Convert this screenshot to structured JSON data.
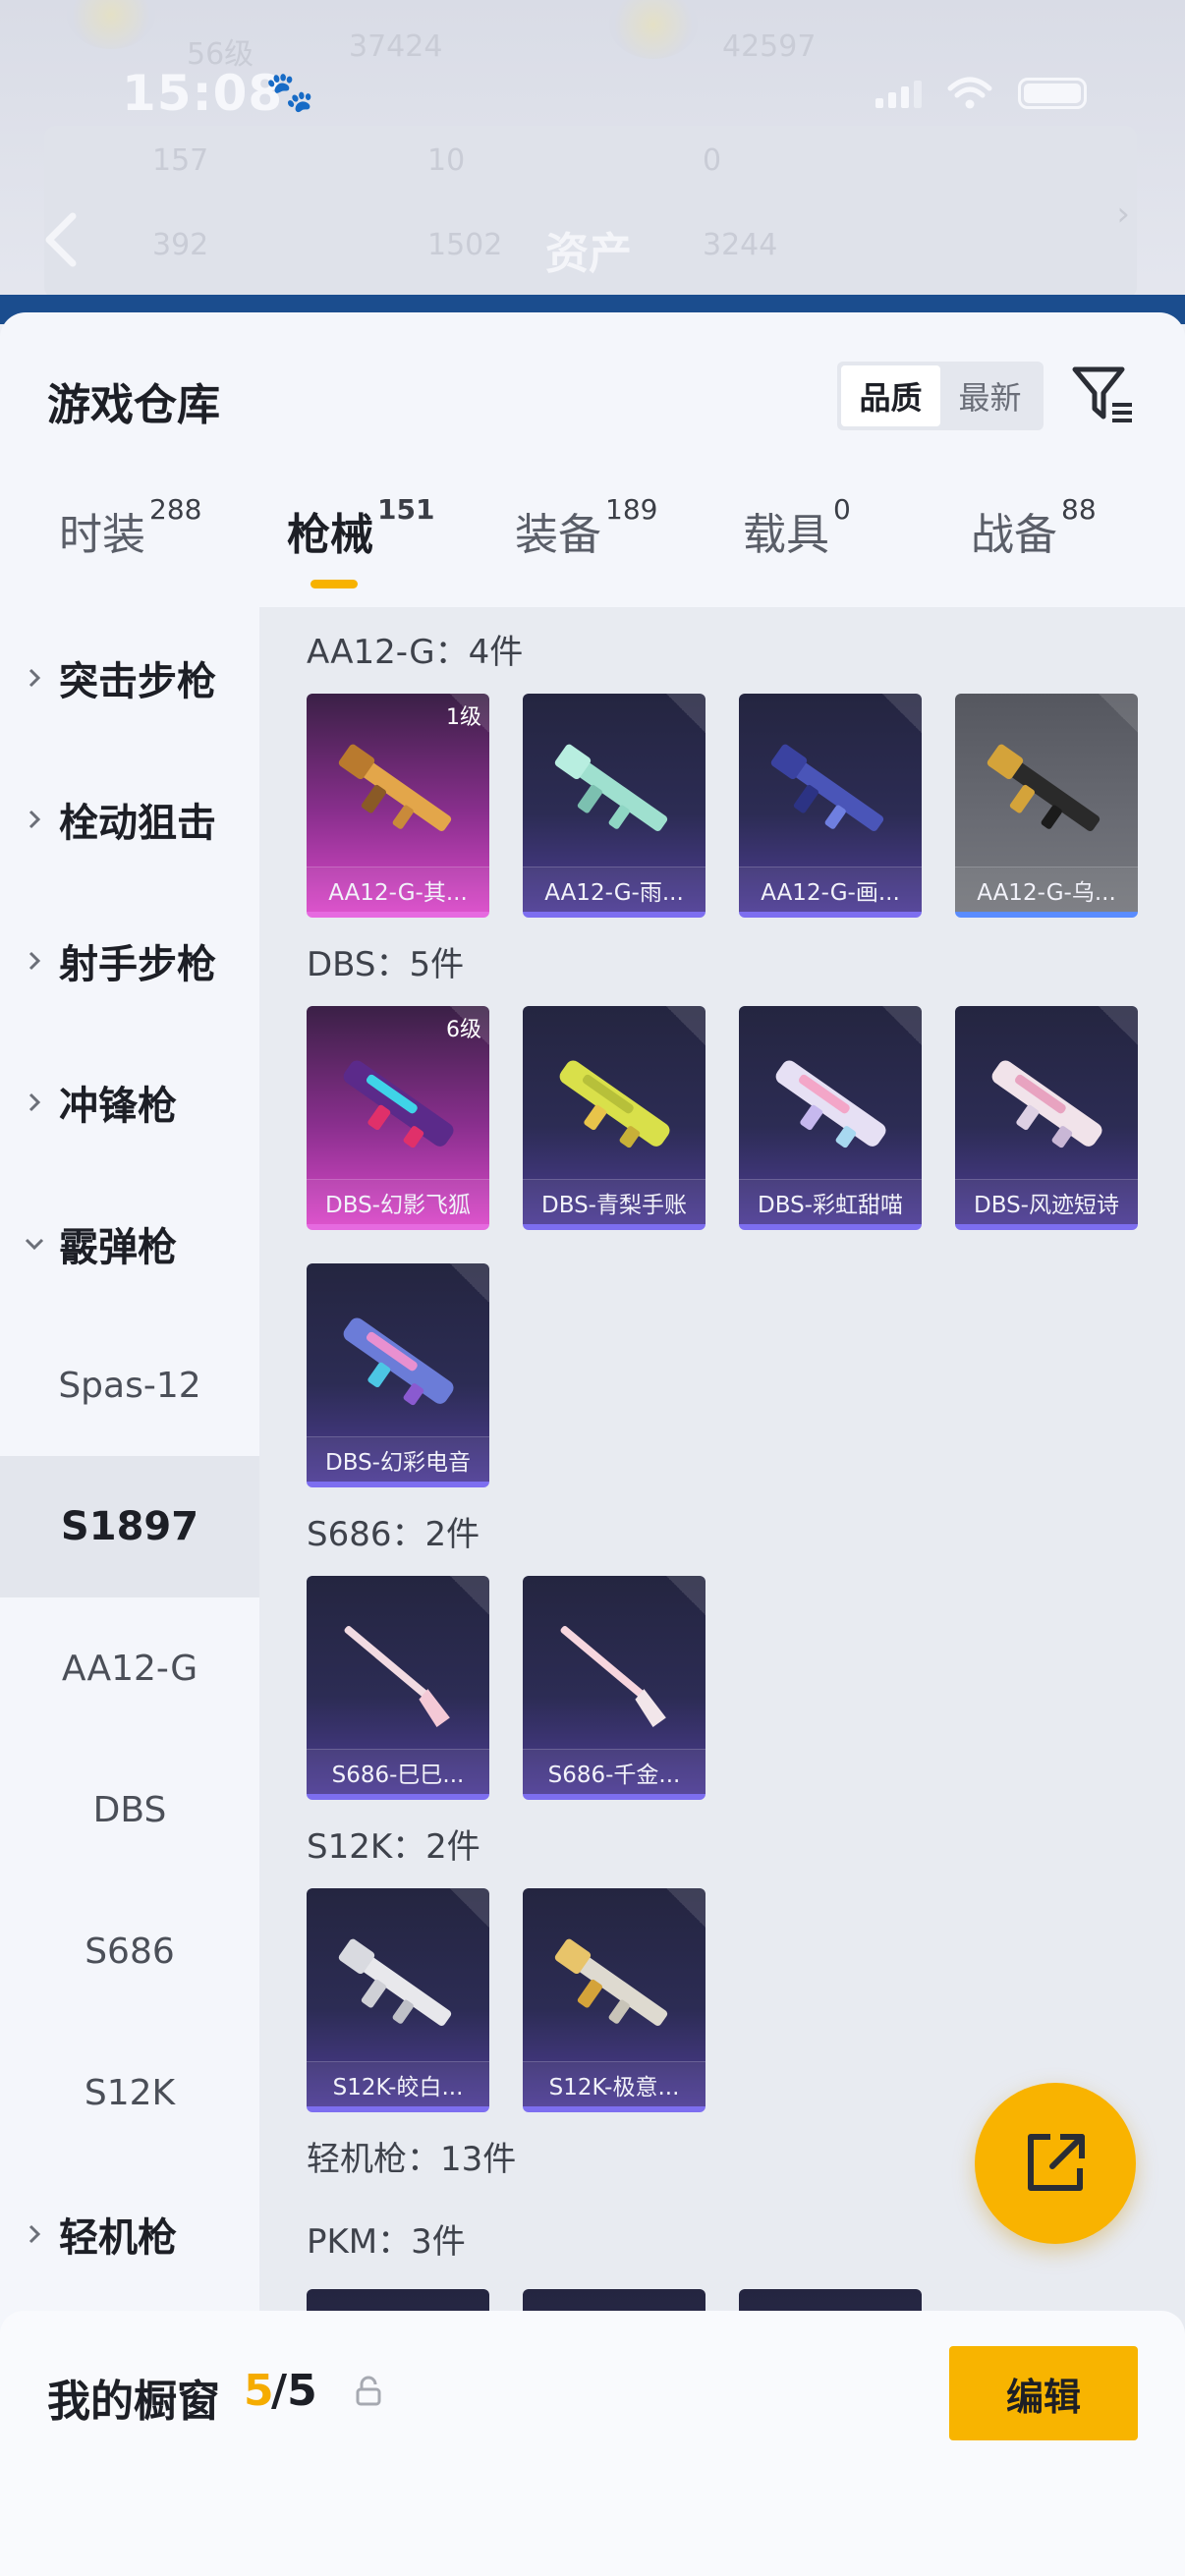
{
  "background_header": {
    "level_text": "56级",
    "score_a": "37424",
    "score_b": "42597",
    "stats_row1": [
      "157",
      "10",
      "0"
    ],
    "stats_row2": [
      "392",
      "1502",
      "3244"
    ],
    "title": "资产"
  },
  "status_bar": {
    "time": "15:08",
    "paw_icon": "paw-icon"
  },
  "sheet": {
    "title": "游戏仓库",
    "sort": {
      "quality": "品质",
      "newest": "最新",
      "selected": "品质"
    },
    "filter_icon": "filter-list-icon"
  },
  "tabs": [
    {
      "label": "时装",
      "count": "288"
    },
    {
      "label": "枪械",
      "count": "151"
    },
    {
      "label": "装备",
      "count": "189"
    },
    {
      "label": "载具",
      "count": "0"
    },
    {
      "label": "战备",
      "count": "88"
    }
  ],
  "categories": {
    "assault_rifle": "突击步枪",
    "bolt_sniper": "栓动狙击",
    "marksman_rifle": "射手步枪",
    "smg": "冲锋枪",
    "shotgun": "霰弹枪",
    "shotgun_subs": [
      "Spas-12",
      "S1897",
      "AA12-G",
      "DBS",
      "S686",
      "S12K"
    ],
    "active_sub": "S1897",
    "lmg": "轻机枪"
  },
  "groups": {
    "aa12g": {
      "header": "AA12-G：4件",
      "items": [
        {
          "name": "AA12-G-其...",
          "level": "1级",
          "rarity": "pink"
        },
        {
          "name": "AA12-G-雨...",
          "rarity": "purple"
        },
        {
          "name": "AA12-G-画...",
          "rarity": "purple"
        },
        {
          "name": "AA12-G-乌...",
          "rarity": "grey"
        }
      ]
    },
    "dbs": {
      "header": "DBS：5件",
      "items": [
        {
          "name": "DBS-幻影飞狐",
          "level": "6级",
          "rarity": "pink"
        },
        {
          "name": "DBS-青梨手账",
          "rarity": "purple"
        },
        {
          "name": "DBS-彩虹甜喵",
          "rarity": "purple"
        },
        {
          "name": "DBS-风迹短诗",
          "rarity": "purple"
        },
        {
          "name": "DBS-幻彩电音",
          "rarity": "purple"
        }
      ]
    },
    "s686": {
      "header": "S686：2件",
      "items": [
        {
          "name": "S686-巳巳...",
          "rarity": "purple"
        },
        {
          "name": "S686-千金...",
          "rarity": "purple"
        }
      ]
    },
    "s12k": {
      "header": "S12K：2件",
      "items": [
        {
          "name": "S12K-皎白...",
          "rarity": "purple"
        },
        {
          "name": "S12K-极意...",
          "rarity": "purple"
        }
      ]
    },
    "lmg_header": "轻机枪：13件",
    "pkm_header": "PKM：3件"
  },
  "fab": {
    "icon": "share-export-icon"
  },
  "showcase": {
    "label": "我的橱窗",
    "count": "5",
    "total": "/5",
    "lock_icon": "lock-icon",
    "edit_label": "编辑"
  },
  "colors": {
    "accent": "#f8b400",
    "rarity_pink": "#d949c8",
    "rarity_purple": "#4e3d95",
    "rarity_grey": "#6a6c74"
  }
}
